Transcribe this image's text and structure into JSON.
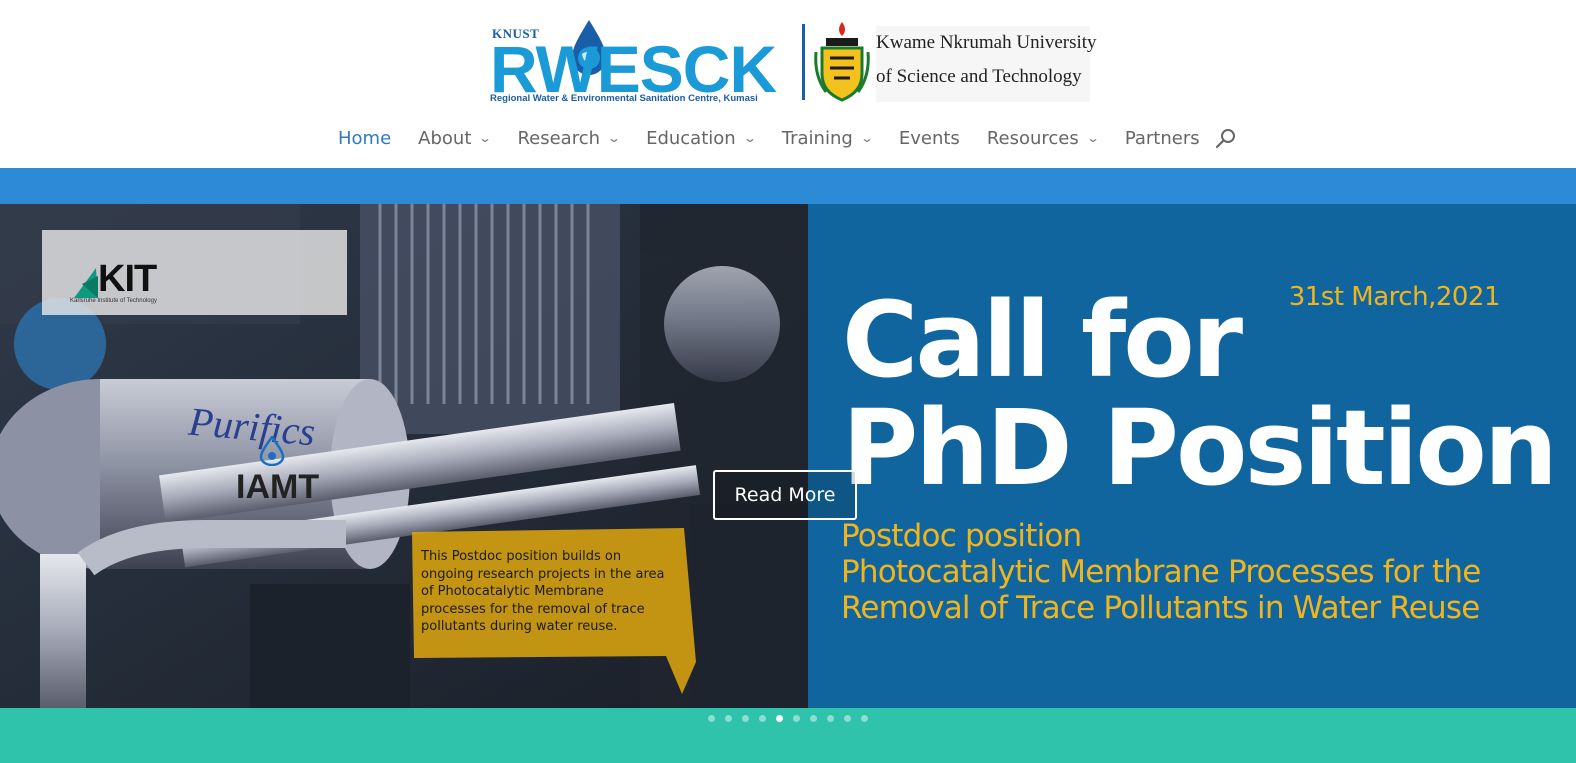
{
  "logo": {
    "org_short": "KNUST",
    "org_mark": "RWESCK",
    "org_tagline": "Regional Water & Environmental Sanitation Centre, Kumasi",
    "university_line1": "Kwame Nkrumah University",
    "university_line2": "of Science and Technology"
  },
  "nav": {
    "items": [
      {
        "label": "Home",
        "active": true,
        "dropdown": false
      },
      {
        "label": "About",
        "dropdown": true
      },
      {
        "label": "Research",
        "dropdown": true
      },
      {
        "label": "Education",
        "dropdown": true
      },
      {
        "label": "Training",
        "dropdown": true
      },
      {
        "label": "Events",
        "dropdown": false
      },
      {
        "label": "Resources",
        "dropdown": true
      },
      {
        "label": "Partners",
        "dropdown": false
      }
    ],
    "chevron": "⌄",
    "search_icon": "search-icon"
  },
  "slide": {
    "partner_logos": {
      "kit": "KIT",
      "kit_sub": "Karlsruhe Institute of Technology",
      "iamt": "IAMT"
    },
    "callout_text": "This Postdoc position builds on ongoing research projects in the area of Photocatalytic Membrane processes for the removal of trace pollutants during water reuse.",
    "date": "31st March,2021",
    "title_line1": "Call for",
    "title_line2": "PhD Position",
    "sub_line1": "Postdoc position",
    "sub_line2": "Photocatalytic Membrane Processes for the",
    "sub_line3": "Removal of Trace Pollutants in Water Reuse",
    "read_more": "Read More"
  },
  "pagination": {
    "total": 10,
    "active_index": 4
  },
  "colors": {
    "accent_blue": "#2d8ad6",
    "slide_bg": "#10659e",
    "highlight_yellow": "#f0b51e",
    "teal": "#2ec3aa",
    "nav_active": "#2e7bc4"
  }
}
